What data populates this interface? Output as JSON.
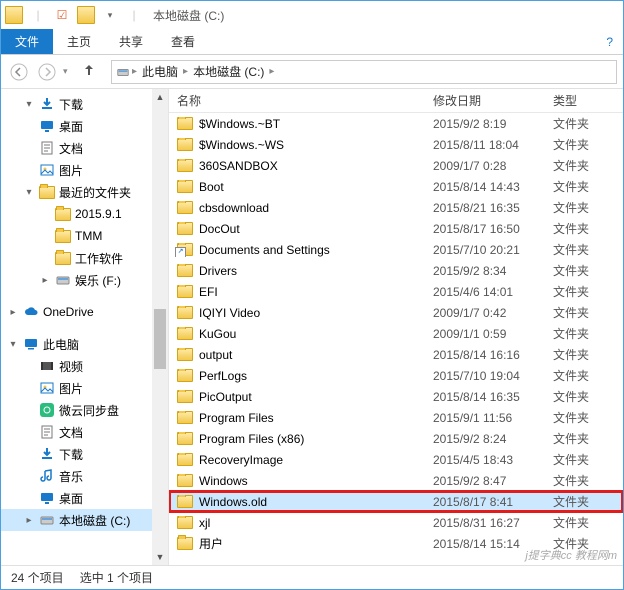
{
  "titlebar": {
    "title": "本地磁盘 (C:)"
  },
  "ribbon": {
    "file": "文件",
    "tabs": [
      "主页",
      "共享",
      "查看"
    ]
  },
  "breadcrumbs": [
    "此电脑",
    "本地磁盘 (C:)"
  ],
  "columns": {
    "name": "名称",
    "date": "修改日期",
    "type": "类型"
  },
  "tree": [
    {
      "label": "下载",
      "depth": 1,
      "exp": "▾",
      "icon": "download",
      "color": "#1979ca"
    },
    {
      "label": "桌面",
      "depth": 1,
      "exp": "",
      "icon": "desktop",
      "color": "#1979ca"
    },
    {
      "label": "文档",
      "depth": 1,
      "exp": "",
      "icon": "doc",
      "color": "#7a7a7a"
    },
    {
      "label": "图片",
      "depth": 1,
      "exp": "",
      "icon": "pic",
      "color": "#1979ca"
    },
    {
      "label": "最近的文件夹",
      "depth": 1,
      "exp": "▾",
      "icon": "folder",
      "color": "#f2c94c"
    },
    {
      "label": "2015.9.1",
      "depth": 2,
      "exp": "",
      "icon": "folder",
      "color": "#f2c94c"
    },
    {
      "label": "TMM",
      "depth": 2,
      "exp": "",
      "icon": "folder",
      "color": "#f2c94c"
    },
    {
      "label": "工作软件",
      "depth": 2,
      "exp": "",
      "icon": "folder",
      "color": "#f2c94c"
    },
    {
      "label": "娱乐 (F:)",
      "depth": 2,
      "exp": "▸",
      "icon": "drive",
      "color": "#888"
    },
    {
      "label": "",
      "depth": 0,
      "spacer": true
    },
    {
      "label": "OneDrive",
      "depth": 0,
      "exp": "▸",
      "icon": "cloud",
      "color": "#1979ca"
    },
    {
      "label": "",
      "depth": 0,
      "spacer": true
    },
    {
      "label": "此电脑",
      "depth": 0,
      "exp": "▾",
      "icon": "pc",
      "color": "#1979ca"
    },
    {
      "label": "视频",
      "depth": 1,
      "exp": "",
      "icon": "video",
      "color": "#555"
    },
    {
      "label": "图片",
      "depth": 1,
      "exp": "",
      "icon": "pic",
      "color": "#1979ca"
    },
    {
      "label": "微云同步盘",
      "depth": 1,
      "exp": "",
      "icon": "sync",
      "color": "#2bbd7e"
    },
    {
      "label": "文档",
      "depth": 1,
      "exp": "",
      "icon": "doc",
      "color": "#7a7a7a"
    },
    {
      "label": "下载",
      "depth": 1,
      "exp": "",
      "icon": "download",
      "color": "#1979ca"
    },
    {
      "label": "音乐",
      "depth": 1,
      "exp": "",
      "icon": "music",
      "color": "#1979ca"
    },
    {
      "label": "桌面",
      "depth": 1,
      "exp": "",
      "icon": "desktop",
      "color": "#1979ca"
    },
    {
      "label": "本地磁盘 (C:)",
      "depth": 1,
      "exp": "▸",
      "icon": "drive",
      "color": "#888",
      "selected": true
    }
  ],
  "files": [
    {
      "name": "$Windows.~BT",
      "date": "2015/9/2 8:19",
      "type": "文件夹"
    },
    {
      "name": "$Windows.~WS",
      "date": "2015/8/11 18:04",
      "type": "文件夹"
    },
    {
      "name": "360SANDBOX",
      "date": "2009/1/7 0:28",
      "type": "文件夹"
    },
    {
      "name": "Boot",
      "date": "2015/8/14 14:43",
      "type": "文件夹"
    },
    {
      "name": "cbsdownload",
      "date": "2015/8/21 16:35",
      "type": "文件夹"
    },
    {
      "name": "DocOut",
      "date": "2015/8/17 16:50",
      "type": "文件夹"
    },
    {
      "name": "Documents and Settings",
      "date": "2015/7/10 20:21",
      "type": "文件夹",
      "shortcut": true
    },
    {
      "name": "Drivers",
      "date": "2015/9/2 8:34",
      "type": "文件夹"
    },
    {
      "name": "EFI",
      "date": "2015/4/6 14:01",
      "type": "文件夹"
    },
    {
      "name": "IQIYI Video",
      "date": "2009/1/7 0:42",
      "type": "文件夹"
    },
    {
      "name": "KuGou",
      "date": "2009/1/1 0:59",
      "type": "文件夹"
    },
    {
      "name": "output",
      "date": "2015/8/14 16:16",
      "type": "文件夹"
    },
    {
      "name": "PerfLogs",
      "date": "2015/7/10 19:04",
      "type": "文件夹"
    },
    {
      "name": "PicOutput",
      "date": "2015/8/14 16:35",
      "type": "文件夹"
    },
    {
      "name": "Program Files",
      "date": "2015/9/1 11:56",
      "type": "文件夹"
    },
    {
      "name": "Program Files (x86)",
      "date": "2015/9/2 8:24",
      "type": "文件夹"
    },
    {
      "name": "RecoveryImage",
      "date": "2015/4/5 18:43",
      "type": "文件夹"
    },
    {
      "name": "Windows",
      "date": "2015/9/2 8:47",
      "type": "文件夹"
    },
    {
      "name": "Windows.old",
      "date": "2015/8/17 8:41",
      "type": "文件夹",
      "selected": true,
      "highlighted": true
    },
    {
      "name": "xjl",
      "date": "2015/8/31 16:27",
      "type": "文件夹"
    },
    {
      "name": "用户",
      "date": "2015/8/14 15:14",
      "type": "文件夹"
    }
  ],
  "status": {
    "count": "24 个项目",
    "selected": "选中 1 个项目"
  },
  "watermark": "j提字典cc 教程网m"
}
